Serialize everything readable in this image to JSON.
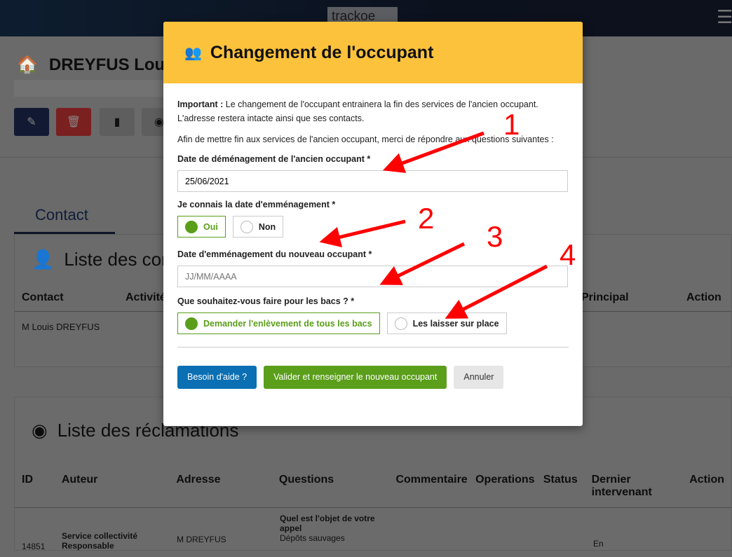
{
  "header": {
    "logo": "trackoe",
    "menu_icon": "hamburger-icon"
  },
  "page": {
    "title": "DREYFUS Louis",
    "tab": "Contact",
    "contacts": {
      "title": "Liste des contacts",
      "columns": [
        "Contact",
        "Activité",
        "Principal",
        "Action"
      ],
      "rows": [
        {
          "contact": "M Louis DREYFUS"
        }
      ]
    },
    "reclamations": {
      "title": "Liste des réclamations",
      "columns": [
        "ID",
        "Auteur",
        "Adresse",
        "Questions",
        "Commentaire",
        "Operations",
        "Status",
        "Dernier intervenant",
        "Action"
      ],
      "row": {
        "id": "14851",
        "auteur": "Service collectivité Responsable",
        "adresse": "M DREYFUS",
        "question": "Quel est l'objet de votre appel",
        "answer": "Dépôts sauvages",
        "status": "En"
      }
    }
  },
  "modal": {
    "title": "Changement de l'occupant",
    "important_label": "Important :",
    "important_text": " Le changement de l'occupant entrainera la fin des services de l'ancien occupant. L'adresse restera intacte ainsi que ses contacts.",
    "intro": "Afin de mettre fin aux services de l'ancien occupant, merci de répondre aux questions suivantes :",
    "q1": "Date de déménagement de l'ancien occupant *",
    "q1_value": "25/06/2021",
    "q2": "Je connais la date d'emménagement *",
    "q2_yes": "Oui",
    "q2_no": "Non",
    "q3": "Date d'emménagement du nouveau occupant *",
    "q3_placeholder": "JJ/MM/AAAA",
    "q4": "Que souhaitez-vous faire pour les bacs ? *",
    "q4_opt1": "Demander l'enlèvement de tous les bacs",
    "q4_opt2": "Les laisser sur place",
    "help": "Besoin d'aide ?",
    "validate": "Valider et renseigner le nouveau occupant",
    "cancel": "Annuler"
  },
  "annotations": [
    "1",
    "2",
    "3",
    "4"
  ],
  "colors": {
    "header": "#fdc23b",
    "green": "#5a9e1a",
    "blue": "#0a6fb3",
    "arrow": "#ff0000"
  }
}
